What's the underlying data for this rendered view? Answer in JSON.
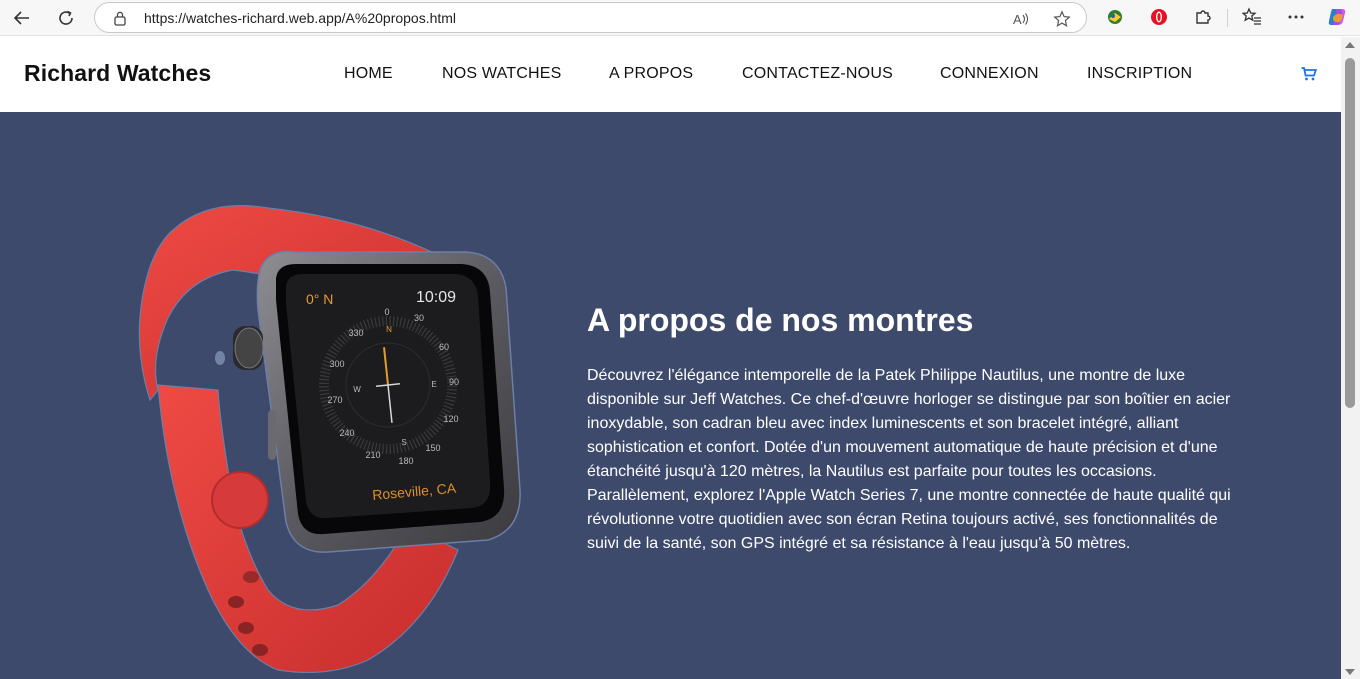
{
  "browser": {
    "url": "https://watches-richard.web.app/A%20propos.html",
    "icons": [
      "back-icon",
      "refresh-icon",
      "lock-icon",
      "read-aloud-icon",
      "favorite-star-icon",
      "extension-icon",
      "opera-icon",
      "puzzle-icon",
      "favorites-icon",
      "more-icon",
      "copilot-icon"
    ]
  },
  "header": {
    "brand": "Richard Watches",
    "nav": [
      "HOME",
      "NOS WATCHES",
      "A PROPOS",
      "CONTACTEZ-NOUS",
      "CONNEXION",
      "INSCRIPTION"
    ],
    "cart_icon": "cart-icon",
    "accent_color": "#1a73e8"
  },
  "hero": {
    "background_color": "#3d4a6b",
    "title": "A propos de nos montres",
    "text": "Découvrez l'élégance intemporelle de la Patek Philippe Nautilus, une montre de luxe disponible sur Jeff Watches. Ce chef-d'œuvre horloger se distingue par son boîtier en acier inoxydable, son cadran bleu avec index luminescents et son bracelet intégré, alliant sophistication et confort. Dotée d'un mouvement automatique de haute précision et d'une étanchéité jusqu'à 120 mètres, la Nautilus est parfaite pour toutes les occasions. Parallèlement, explorez l'Apple Watch Series 7, une montre connectée de haute qualité qui révolutionne votre quotidien avec son écran Retina toujours activé, ses fonctionnalités de suivi de la santé, son GPS intégré et sa résistance à l'eau jusqu'à 50 mètres.",
    "watch": {
      "heading": "0° N",
      "time": "10:09",
      "location": "Roseville, CA",
      "compass_numbers": [
        "0",
        "30",
        "60",
        "90",
        "120",
        "150",
        "180",
        "210",
        "240",
        "270",
        "300",
        "330"
      ],
      "compass_letters": [
        "N",
        "E",
        "S",
        "W"
      ]
    }
  }
}
